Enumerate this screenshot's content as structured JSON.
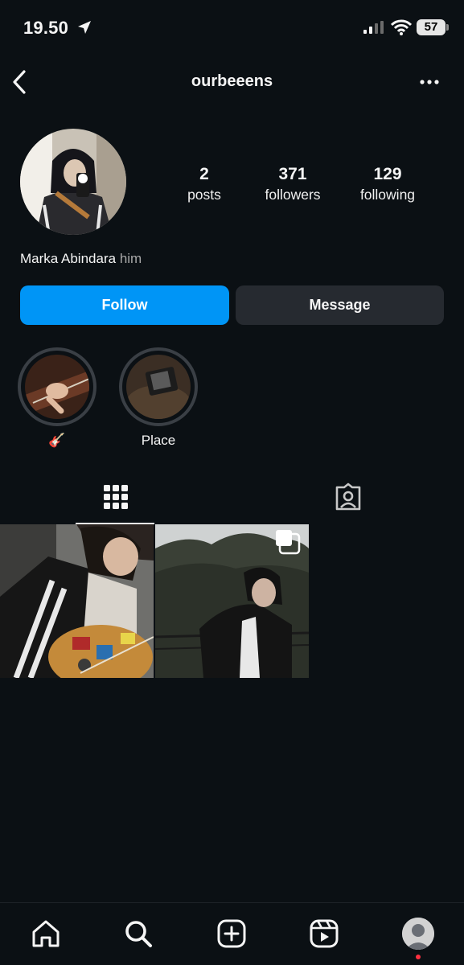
{
  "status": {
    "time": "19.50",
    "battery": "57"
  },
  "header": {
    "username": "ourbeeens"
  },
  "profile": {
    "name": "Marka Abindara",
    "pronouns": "him",
    "stats": [
      {
        "value": "2",
        "label": "posts"
      },
      {
        "value": "371",
        "label": "followers"
      },
      {
        "value": "129",
        "label": "following"
      }
    ]
  },
  "actions": {
    "follow": "Follow",
    "message": "Message"
  },
  "highlights": [
    {
      "label": "🎸"
    },
    {
      "label": "Place"
    }
  ],
  "tabs": [
    "grid-icon",
    "tagged-icon"
  ],
  "nav": [
    "home-icon",
    "search-icon",
    "create-icon",
    "reels-icon",
    "profile-avatar"
  ],
  "colors": {
    "background": "#0b1014",
    "accent": "#0095f6",
    "secondary_button": "#262a30"
  }
}
